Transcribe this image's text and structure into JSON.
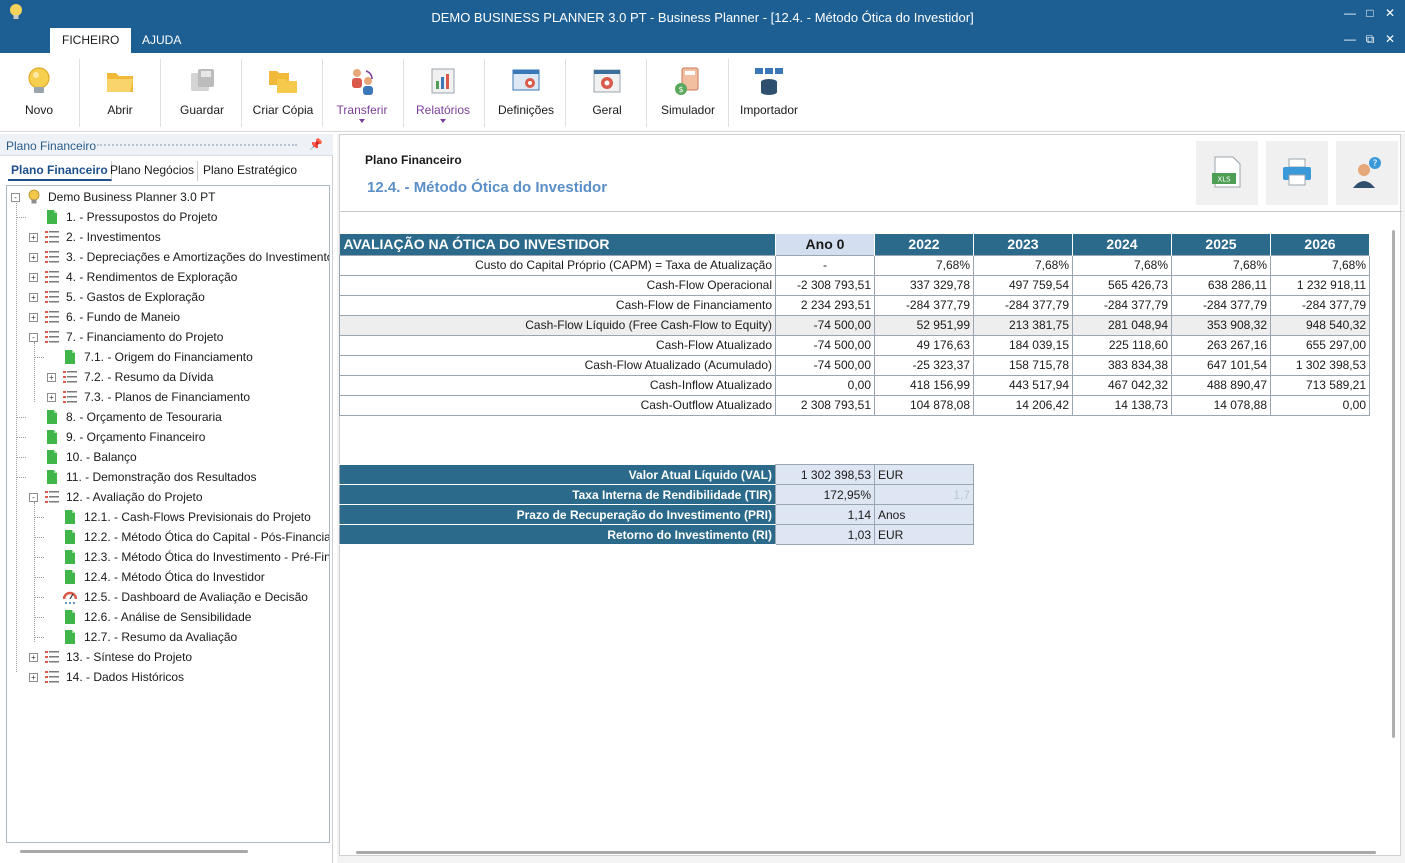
{
  "window": {
    "title": "DEMO BUSINESS PLANNER 3.0 PT - Business Planner - [12.4. - Método Ótica do Investidor]",
    "menu_tabs": [
      "FICHEIRO",
      "AJUDA"
    ]
  },
  "ribbon": {
    "buttons": [
      {
        "label": "Novo",
        "icon": "lightbulb-icon"
      },
      {
        "label": "Abrir",
        "icon": "folder-open-icon"
      },
      {
        "label": "Guardar",
        "icon": "save-disk-icon"
      },
      {
        "label": "Criar Cópia",
        "icon": "folder-copy-icon"
      },
      {
        "label": "Transferir",
        "icon": "transfer-users-icon"
      },
      {
        "label": "Relatórios",
        "icon": "reports-icon"
      },
      {
        "label": "Definições",
        "icon": "settings-window-icon"
      },
      {
        "label": "Geral",
        "icon": "gear-icon"
      },
      {
        "label": "Simulador",
        "icon": "simulator-icon"
      },
      {
        "label": "Importador",
        "icon": "importer-database-icon"
      }
    ]
  },
  "left_panel": {
    "header": "Plano Financeiro",
    "tabs": [
      "Plano Financeiro",
      "Plano Negócios",
      "Plano Estratégico"
    ],
    "tree": [
      {
        "label": "Demo Business Planner 3.0 PT",
        "level": 0,
        "icon": "bulb",
        "expander": "-"
      },
      {
        "label": "1. - Pressupostos do Projeto",
        "level": 1,
        "icon": "doc",
        "expander": ""
      },
      {
        "label": "2. - Investimentos",
        "level": 1,
        "icon": "list",
        "expander": "+"
      },
      {
        "label": "3. - Depreciações e Amortizações do Investimento",
        "level": 1,
        "icon": "list",
        "expander": "+"
      },
      {
        "label": "4. - Rendimentos de Exploração",
        "level": 1,
        "icon": "list",
        "expander": "+"
      },
      {
        "label": "5. - Gastos de Exploração",
        "level": 1,
        "icon": "list",
        "expander": "+"
      },
      {
        "label": "6. - Fundo de Maneio",
        "level": 1,
        "icon": "list",
        "expander": "+"
      },
      {
        "label": "7. - Financiamento do Projeto",
        "level": 1,
        "icon": "list",
        "expander": "-"
      },
      {
        "label": "7.1. - Origem do Financiamento",
        "level": 2,
        "icon": "doc",
        "expander": ""
      },
      {
        "label": "7.2. - Resumo da Dívida",
        "level": 2,
        "icon": "list",
        "expander": "+"
      },
      {
        "label": "7.3. - Planos de Financiamento",
        "level": 2,
        "icon": "list",
        "expander": "+"
      },
      {
        "label": "8. - Orçamento de Tesouraria",
        "level": 1,
        "icon": "doc",
        "expander": ""
      },
      {
        "label": "9. - Orçamento Financeiro",
        "level": 1,
        "icon": "doc",
        "expander": ""
      },
      {
        "label": "10. - Balanço",
        "level": 1,
        "icon": "doc",
        "expander": ""
      },
      {
        "label": "11. - Demonstração dos Resultados",
        "level": 1,
        "icon": "doc",
        "expander": ""
      },
      {
        "label": "12. - Avaliação do Projeto",
        "level": 1,
        "icon": "list",
        "expander": "-"
      },
      {
        "label": "12.1. - Cash-Flows Previsionais do Projeto",
        "level": 2,
        "icon": "doc",
        "expander": ""
      },
      {
        "label": "12.2. - Método Ótica do Capital - Pós-Financiamento",
        "level": 2,
        "icon": "doc",
        "expander": ""
      },
      {
        "label": "12.3. - Método Ótica do Investimento - Pré-Financiamento",
        "level": 2,
        "icon": "doc",
        "expander": ""
      },
      {
        "label": "12.4. - Método Ótica do Investidor",
        "level": 2,
        "icon": "doc",
        "expander": ""
      },
      {
        "label": "12.5. - Dashboard de Avaliação e Decisão",
        "level": 2,
        "icon": "gauge",
        "expander": ""
      },
      {
        "label": "12.6. - Análise de Sensibilidade",
        "level": 2,
        "icon": "doc",
        "expander": ""
      },
      {
        "label": "12.7. - Resumo da Avaliação",
        "level": 2,
        "icon": "doc",
        "expander": ""
      },
      {
        "label": "13. - Síntese do Projeto",
        "level": 1,
        "icon": "list",
        "expander": "+"
      },
      {
        "label": "14. - Dados Históricos",
        "level": 1,
        "icon": "list",
        "expander": "+"
      }
    ]
  },
  "main": {
    "section": "Plano Financeiro",
    "title": "12.4. - Método Ótica do Investidor",
    "tool_buttons": [
      {
        "name": "export-excel-button",
        "icon": "xls-file-icon",
        "caption": "XLS"
      },
      {
        "name": "print-button",
        "icon": "printer-icon"
      },
      {
        "name": "help-button",
        "icon": "help-person-icon"
      }
    ],
    "table": {
      "header": [
        "AVALIAÇÃO NA ÓTICA DO INVESTIDOR",
        "Ano 0",
        "2022",
        "2023",
        "2024",
        "2025",
        "2026"
      ],
      "rows": [
        {
          "label": "Custo do Capital Próprio (CAPM) = Taxa de Atualização",
          "values": [
            "-",
            "7,68%",
            "7,68%",
            "7,68%",
            "7,68%",
            "7,68%"
          ],
          "ano0_align": "center"
        },
        {
          "label": "Cash-Flow Operacional",
          "values": [
            "-2 308 793,51",
            "337 329,78",
            "497 759,54",
            "565 426,73",
            "638 286,11",
            "1 232 918,11"
          ]
        },
        {
          "label": "Cash-Flow de Financiamento",
          "values": [
            "2 234 293,51",
            "-284 377,79",
            "-284 377,79",
            "-284 377,79",
            "-284 377,79",
            "-284 377,79"
          ]
        },
        {
          "label": "Cash-Flow Líquido (Free Cash-Flow to Equity)",
          "values": [
            "-74 500,00",
            "52 951,99",
            "213 381,75",
            "281 048,94",
            "353 908,32",
            "948 540,32"
          ],
          "shaded": true
        },
        {
          "label": "Cash-Flow Atualizado",
          "values": [
            "-74 500,00",
            "49 176,63",
            "184 039,15",
            "225 118,60",
            "263 267,16",
            "655 297,00"
          ]
        },
        {
          "label": "Cash-Flow Atualizado (Acumulado)",
          "values": [
            "-74 500,00",
            "-25 323,37",
            "158 715,78",
            "383 834,38",
            "647 101,54",
            "1 302 398,53"
          ]
        },
        {
          "label": "Cash-Inflow Atualizado",
          "values": [
            "0,00",
            "418 156,99",
            "443 517,94",
            "467 042,32",
            "488 890,47",
            "713 589,21"
          ]
        },
        {
          "label": "Cash-Outflow Atualizado",
          "values": [
            "2 308 793,51",
            "104 878,08",
            "14 206,42",
            "14 138,73",
            "14 078,88",
            "0,00"
          ]
        }
      ]
    },
    "summary": [
      {
        "label": "Valor Atual Líquido (VAL)",
        "value": "1 302 398,53",
        "unit": "EUR",
        "faint": false
      },
      {
        "label": "Taxa Interna de Rendibilidade (TIR)",
        "value": "172,95%",
        "unit": "1,7",
        "faint": true
      },
      {
        "label": "Prazo de Recuperação do Investimento (PRI)",
        "value": "1,14",
        "unit": "Anos",
        "faint": false
      },
      {
        "label": "Retorno do Investimento (RI)",
        "value": "1,03",
        "unit": "EUR",
        "faint": false
      }
    ]
  },
  "colors": {
    "titlebar": "#1d5f93",
    "table_header": "#2b6a8a",
    "ano0_header": "#d3dff0",
    "accent_title": "#5b8fc7",
    "summary_value_bg": "#dde6f2"
  }
}
